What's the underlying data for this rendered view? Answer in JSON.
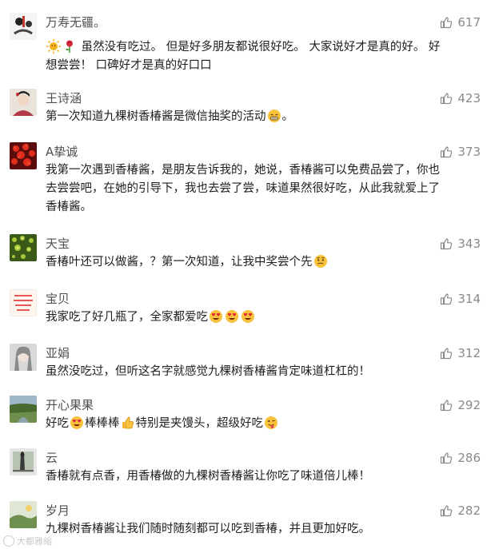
{
  "colors": {
    "username": "#505050",
    "text": "#1e1e1e",
    "likes": "#8a8a8a"
  },
  "comments": [
    {
      "user": "万寿无疆。",
      "likes": "617",
      "lines": [
        "虽然没有吃过。 但是好多朋友都说很好吃。 大家说好才是真的好。 好",
        "想尝尝！ 口碑好才是真的好口口"
      ],
      "icons": [
        "sun-emoji",
        "rose-emoji"
      ]
    },
    {
      "user": "王诗涵",
      "likes": "423",
      "lines": [
        "第一次知道九棵树香椿酱是微信抽奖的活动",
        "。"
      ],
      "icons": [
        "grin-emoji"
      ]
    },
    {
      "user": "A挚诚",
      "likes": "373",
      "lines": [
        "我第一次遇到香椿酱，是朋友告诉我的，她说，香椿酱可以免费品尝了，你也",
        "去尝尝吧，在她的引导下，我也去尝了尝，味道果然很好吃，从此我就爱上了",
        "香椿酱。"
      ]
    },
    {
      "user": "天宝",
      "likes": "343",
      "lines": [
        "香椿叶还可以做酱，？第一次知道，让我中奖尝个先"
      ],
      "icons": [
        "hopeful-emoji"
      ]
    },
    {
      "user": "宝贝",
      "likes": "314",
      "lines": [
        "我家吃了好几瓶了，全家都爱吃"
      ],
      "icons": [
        "heart-eyes-emoji",
        "heart-eyes-emoji",
        "heart-eyes-emoji"
      ]
    },
    {
      "user": "亚娟",
      "likes": "312",
      "lines": [
        "虽然没吃过，但听这名字就感觉九棵树香椿酱肯定味道杠杠的！"
      ]
    },
    {
      "user": "开心果果",
      "likes": "292",
      "lines": [
        "好吃",
        "棒棒棒",
        "特别是夹馒头，超级好吃"
      ],
      "icons": [
        "heart-eyes-emoji",
        "thumbs-up-emoji",
        "tongue-wink-emoji"
      ]
    },
    {
      "user": "云",
      "likes": "286",
      "lines": [
        "香椿就有点香，用香椿做的九棵树香椿酱让你吃了味道倍儿棒！"
      ]
    },
    {
      "user": "岁月",
      "likes": "282",
      "lines": [
        "九棵树香椿酱让我们随时随刻都可以吃到香椿，并且更加好吃。"
      ]
    }
  ],
  "watermark": "大都雅缩"
}
